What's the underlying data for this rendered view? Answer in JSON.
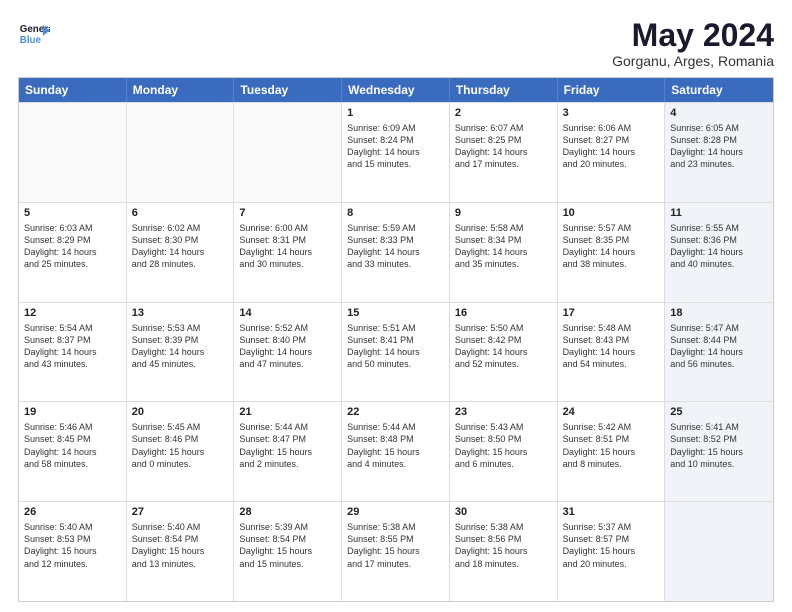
{
  "logo": {
    "line1": "General",
    "line2": "Blue"
  },
  "title": "May 2024",
  "subtitle": "Gorganu, Arges, Romania",
  "headers": [
    "Sunday",
    "Monday",
    "Tuesday",
    "Wednesday",
    "Thursday",
    "Friday",
    "Saturday"
  ],
  "rows": [
    [
      {
        "day": "",
        "text": "",
        "empty": true
      },
      {
        "day": "",
        "text": "",
        "empty": true
      },
      {
        "day": "",
        "text": "",
        "empty": true
      },
      {
        "day": "1",
        "text": "Sunrise: 6:09 AM\nSunset: 8:24 PM\nDaylight: 14 hours\nand 15 minutes."
      },
      {
        "day": "2",
        "text": "Sunrise: 6:07 AM\nSunset: 8:25 PM\nDaylight: 14 hours\nand 17 minutes."
      },
      {
        "day": "3",
        "text": "Sunrise: 6:06 AM\nSunset: 8:27 PM\nDaylight: 14 hours\nand 20 minutes."
      },
      {
        "day": "4",
        "text": "Sunrise: 6:05 AM\nSunset: 8:28 PM\nDaylight: 14 hours\nand 23 minutes.",
        "shaded": true
      }
    ],
    [
      {
        "day": "5",
        "text": "Sunrise: 6:03 AM\nSunset: 8:29 PM\nDaylight: 14 hours\nand 25 minutes."
      },
      {
        "day": "6",
        "text": "Sunrise: 6:02 AM\nSunset: 8:30 PM\nDaylight: 14 hours\nand 28 minutes."
      },
      {
        "day": "7",
        "text": "Sunrise: 6:00 AM\nSunset: 8:31 PM\nDaylight: 14 hours\nand 30 minutes."
      },
      {
        "day": "8",
        "text": "Sunrise: 5:59 AM\nSunset: 8:33 PM\nDaylight: 14 hours\nand 33 minutes."
      },
      {
        "day": "9",
        "text": "Sunrise: 5:58 AM\nSunset: 8:34 PM\nDaylight: 14 hours\nand 35 minutes."
      },
      {
        "day": "10",
        "text": "Sunrise: 5:57 AM\nSunset: 8:35 PM\nDaylight: 14 hours\nand 38 minutes."
      },
      {
        "day": "11",
        "text": "Sunrise: 5:55 AM\nSunset: 8:36 PM\nDaylight: 14 hours\nand 40 minutes.",
        "shaded": true
      }
    ],
    [
      {
        "day": "12",
        "text": "Sunrise: 5:54 AM\nSunset: 8:37 PM\nDaylight: 14 hours\nand 43 minutes."
      },
      {
        "day": "13",
        "text": "Sunrise: 5:53 AM\nSunset: 8:39 PM\nDaylight: 14 hours\nand 45 minutes."
      },
      {
        "day": "14",
        "text": "Sunrise: 5:52 AM\nSunset: 8:40 PM\nDaylight: 14 hours\nand 47 minutes."
      },
      {
        "day": "15",
        "text": "Sunrise: 5:51 AM\nSunset: 8:41 PM\nDaylight: 14 hours\nand 50 minutes."
      },
      {
        "day": "16",
        "text": "Sunrise: 5:50 AM\nSunset: 8:42 PM\nDaylight: 14 hours\nand 52 minutes."
      },
      {
        "day": "17",
        "text": "Sunrise: 5:48 AM\nSunset: 8:43 PM\nDaylight: 14 hours\nand 54 minutes."
      },
      {
        "day": "18",
        "text": "Sunrise: 5:47 AM\nSunset: 8:44 PM\nDaylight: 14 hours\nand 56 minutes.",
        "shaded": true
      }
    ],
    [
      {
        "day": "19",
        "text": "Sunrise: 5:46 AM\nSunset: 8:45 PM\nDaylight: 14 hours\nand 58 minutes."
      },
      {
        "day": "20",
        "text": "Sunrise: 5:45 AM\nSunset: 8:46 PM\nDaylight: 15 hours\nand 0 minutes."
      },
      {
        "day": "21",
        "text": "Sunrise: 5:44 AM\nSunset: 8:47 PM\nDaylight: 15 hours\nand 2 minutes."
      },
      {
        "day": "22",
        "text": "Sunrise: 5:44 AM\nSunset: 8:48 PM\nDaylight: 15 hours\nand 4 minutes."
      },
      {
        "day": "23",
        "text": "Sunrise: 5:43 AM\nSunset: 8:50 PM\nDaylight: 15 hours\nand 6 minutes."
      },
      {
        "day": "24",
        "text": "Sunrise: 5:42 AM\nSunset: 8:51 PM\nDaylight: 15 hours\nand 8 minutes."
      },
      {
        "day": "25",
        "text": "Sunrise: 5:41 AM\nSunset: 8:52 PM\nDaylight: 15 hours\nand 10 minutes.",
        "shaded": true
      }
    ],
    [
      {
        "day": "26",
        "text": "Sunrise: 5:40 AM\nSunset: 8:53 PM\nDaylight: 15 hours\nand 12 minutes."
      },
      {
        "day": "27",
        "text": "Sunrise: 5:40 AM\nSunset: 8:54 PM\nDaylight: 15 hours\nand 13 minutes."
      },
      {
        "day": "28",
        "text": "Sunrise: 5:39 AM\nSunset: 8:54 PM\nDaylight: 15 hours\nand 15 minutes."
      },
      {
        "day": "29",
        "text": "Sunrise: 5:38 AM\nSunset: 8:55 PM\nDaylight: 15 hours\nand 17 minutes."
      },
      {
        "day": "30",
        "text": "Sunrise: 5:38 AM\nSunset: 8:56 PM\nDaylight: 15 hours\nand 18 minutes."
      },
      {
        "day": "31",
        "text": "Sunrise: 5:37 AM\nSunset: 8:57 PM\nDaylight: 15 hours\nand 20 minutes."
      },
      {
        "day": "",
        "text": "",
        "empty": true,
        "shaded": true
      }
    ]
  ]
}
